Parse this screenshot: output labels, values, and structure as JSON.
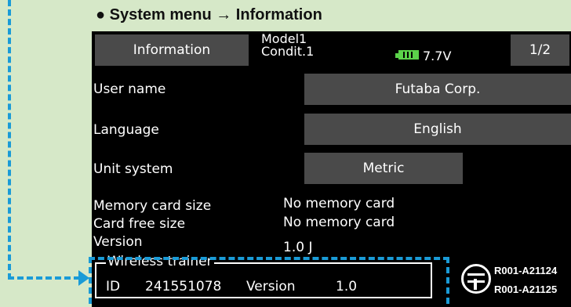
{
  "heading": "● System menu → Information",
  "header": {
    "tab_label": "Information",
    "model_line1": "Model1",
    "model_line2": "Condit.1",
    "battery_voltage": "7.7V",
    "page": "1/2"
  },
  "rows": {
    "user_name": {
      "label": "User name",
      "value": "Futaba Corp."
    },
    "language": {
      "label": "Language",
      "value": "English"
    },
    "unit_system": {
      "label": "Unit system",
      "value": "Metric"
    },
    "memory_card_size": {
      "label": "Memory card size",
      "value": "No memory card"
    },
    "card_free_size": {
      "label": "Card free size",
      "value": "No memory card"
    },
    "version": {
      "label": "Version",
      "value": "1.0 J"
    }
  },
  "wireless_trainer": {
    "title": "Wireless trainer",
    "id_label": "ID",
    "id_value": "241551078",
    "version_label": "Version",
    "version_value": "1.0"
  },
  "certifications": [
    "R001-A21124",
    "R001-A21125"
  ],
  "colors": {
    "accent": "#1a9bd7",
    "battery": "#5bd24a",
    "panel": "#4a4a4a",
    "background": "#d6e8c8"
  },
  "icons": {
    "battery": "battery-icon",
    "certification": "certification-mark-icon",
    "arrow": "arrow-right-icon"
  }
}
